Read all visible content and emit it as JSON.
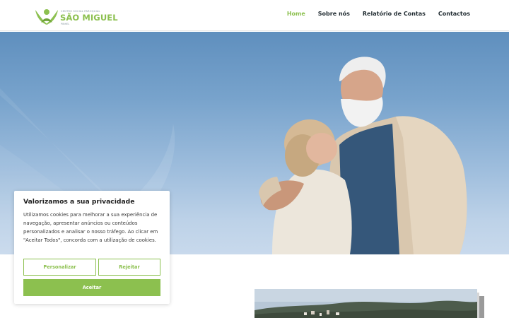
{
  "header": {
    "logo": {
      "small_text": "CENTRO SOCIAL PAROQUIAL",
      "name": "SÃO MIGUEL",
      "sub_text": "PINHEL",
      "icon": "person-leaf-logo-icon"
    },
    "nav": [
      {
        "label": "Home",
        "active": true
      },
      {
        "label": "Sobre nós",
        "active": false
      },
      {
        "label": "Relatório de Contas",
        "active": false
      },
      {
        "label": "Contactos",
        "active": false
      }
    ]
  },
  "hero": {
    "image": "elderly-couple-embracing-sky-photo"
  },
  "cookie_banner": {
    "title": "Valorizamos a sua privacidade",
    "text": "Utilizamos cookies para melhorar a sua experiência de navegação, apresentar anúncios ou conteúdos personalizados e analisar o nosso tráfego. Ao clicar em \"Aceitar Todos\", concorda com a utilização de cookies.",
    "customize_label": "Personalizar",
    "reject_label": "Rejeitar",
    "accept_label": "Aceitar"
  },
  "lower": {
    "image": "town-landscape-photo"
  },
  "colors": {
    "brand_green": "#8cc04f",
    "nav_text": "#1f2a30",
    "sky": "#78a3cc"
  }
}
